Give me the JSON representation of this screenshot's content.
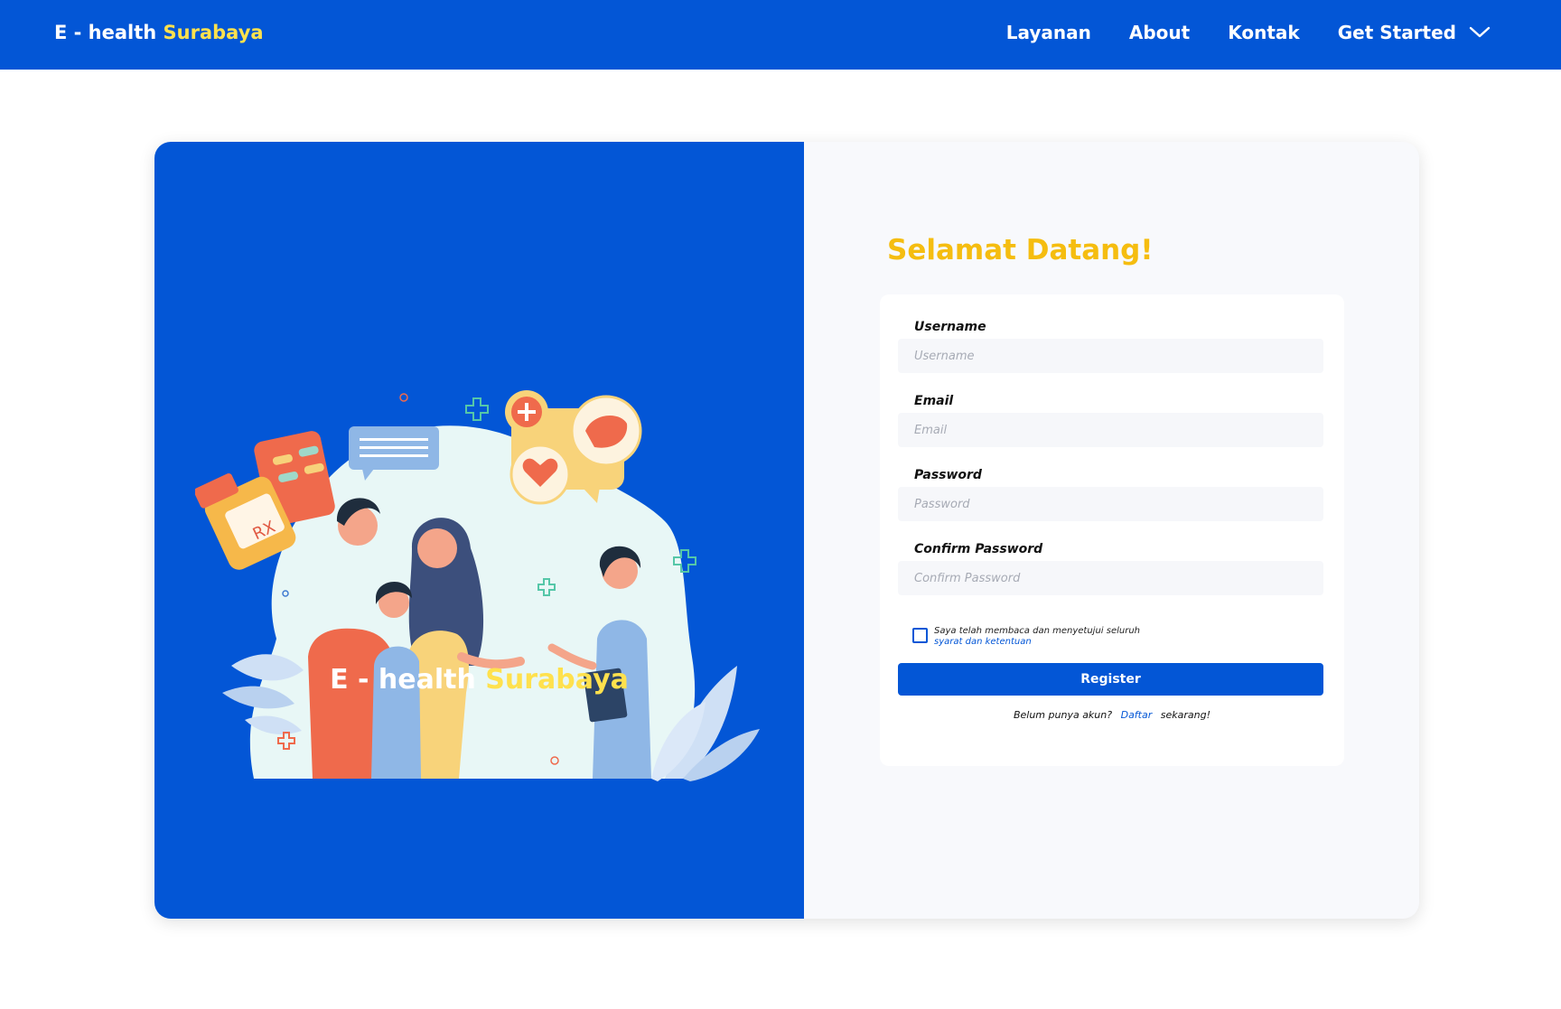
{
  "navbar": {
    "brand_main": "E - health",
    "brand_accent": "Surabaya",
    "links": [
      "Layanan",
      "About",
      "Kontak"
    ],
    "get_started": "Get Started"
  },
  "left_panel": {
    "brand_main": "E - health",
    "brand_accent": "Surabaya",
    "illustration_text": "RX"
  },
  "form": {
    "welcome": "Selamat Datang!",
    "fields": [
      {
        "label": "Username",
        "placeholder": "Username"
      },
      {
        "label": "Email",
        "placeholder": "Email"
      },
      {
        "label": "Password",
        "placeholder": "Password"
      },
      {
        "label": "Confirm Password",
        "placeholder": "Confirm Password"
      }
    ],
    "terms_text": "Saya telah membaca dan menyetujui seluruh",
    "terms_link": "syarat dan ketentuan",
    "register_label": "Register",
    "signup_prefix": "Belum punya akun?",
    "signup_link": "Daftar",
    "signup_suffix": "sekarang!"
  },
  "colors": {
    "primary": "#0356d6",
    "accent_yellow": "#ffe14d",
    "welcome_yellow": "#f5bd10"
  }
}
